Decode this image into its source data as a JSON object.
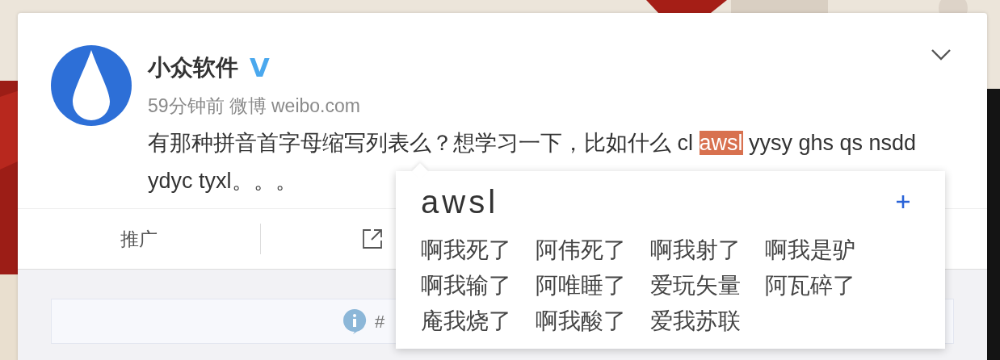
{
  "post": {
    "author": "小众软件",
    "verified_mark": "V",
    "time": "59分钟前",
    "source": "微博 weibo.com",
    "body": [
      {
        "text": "有那种拼音首字母缩写列表么？想学习一下，比如什么 cl ",
        "highlighted": false
      },
      {
        "text": "awsl",
        "highlighted": true
      },
      {
        "text": " yysy ghs qs nsdd ydyc tyxl。。。",
        "highlighted": false
      }
    ],
    "actions": [
      {
        "kind": "text",
        "label": "推广"
      },
      {
        "kind": "share"
      }
    ],
    "notice": {
      "text": "#"
    }
  },
  "popup": {
    "term": "awsl",
    "meanings": [
      "啊我死了",
      "阿伟死了",
      "啊我射了",
      "啊我是驴",
      "啊我输了",
      "阿唯睡了",
      "爱玩矢量",
      "阿瓦碎了",
      "庵我烧了",
      "啊我酸了",
      "爱我苏联"
    ]
  }
}
